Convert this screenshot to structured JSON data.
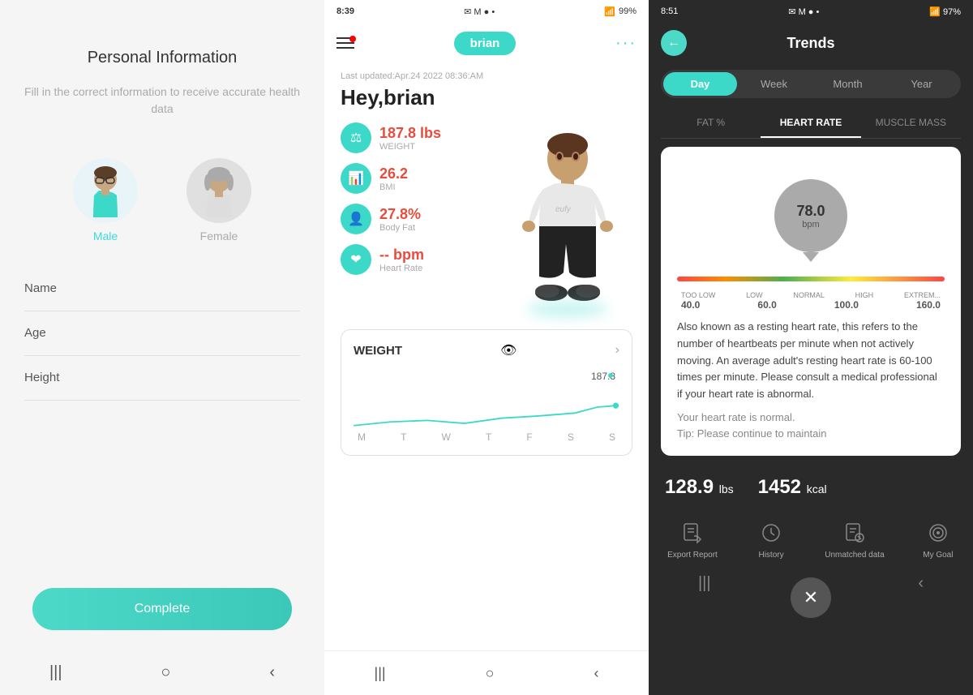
{
  "panel1": {
    "title": "Personal Information",
    "subtitle": "Fill in the correct information to receive accurate health data",
    "genders": [
      {
        "label": "Male",
        "active": true
      },
      {
        "label": "Female",
        "active": false
      }
    ],
    "fields": [
      {
        "label": "Name"
      },
      {
        "label": "Age"
      },
      {
        "label": "Height"
      }
    ],
    "complete_button": "Complete"
  },
  "panel2": {
    "status_bar": {
      "time": "8:39",
      "icons": "✉ M ● •",
      "right": "📶 99%"
    },
    "brand": "brian",
    "last_updated": "Last updated:Apr.24 2022 08:36:AM",
    "greeting": "Hey,brian",
    "stats": [
      {
        "value": "187.8 lbs",
        "label": "WEIGHT"
      },
      {
        "value": "26.2",
        "label": "BMI"
      },
      {
        "value": "27.8%",
        "label": "Body Fat"
      },
      {
        "value": "-- bpm",
        "label": "Heart Rate"
      }
    ],
    "weight_card": {
      "title": "WEIGHT",
      "value": "187.8",
      "days": [
        "M",
        "T",
        "W",
        "T",
        "F",
        "S",
        "S"
      ]
    }
  },
  "panel3": {
    "status_bar": {
      "time": "8:51",
      "icons": "✉ M ● •",
      "right": "📶 97%"
    },
    "title": "Trends",
    "period_tabs": [
      "Day",
      "Week",
      "Month",
      "Year"
    ],
    "active_period": "Day",
    "metric_tabs": [
      "FAT %",
      "HEART RATE",
      "MUSCLE MASS"
    ],
    "active_metric": "HEART RATE",
    "gauge": {
      "value": "78.0",
      "unit": "bpm",
      "labels": [
        "TOO LOW",
        "LOW",
        "NORMAL",
        "HIGH",
        "EXTREM..."
      ],
      "numbers": [
        "40.0",
        "60.0",
        "100.0",
        "160.0"
      ]
    },
    "description": "Also known as a resting heart rate, this refers to the number of heartbeats per minute when not actively moving. An average adult's resting heart rate is 60-100 times per minute. Please consult a medical professional if your heart rate is abnormal.",
    "status_text": "Your heart rate is normal.",
    "tip_text": "Tip: Please continue to maintain",
    "bottom_stats": [
      {
        "value": "128.9",
        "unit": "lbs"
      },
      {
        "value": "1452",
        "unit": "kcal"
      }
    ],
    "action_bar": [
      {
        "icon": "📊",
        "label": "Export Report"
      },
      {
        "icon": "🕐",
        "label": "History"
      },
      {
        "icon": "📋",
        "label": "Unmatched data"
      },
      {
        "icon": "🎯",
        "label": "My Goal"
      }
    ]
  }
}
